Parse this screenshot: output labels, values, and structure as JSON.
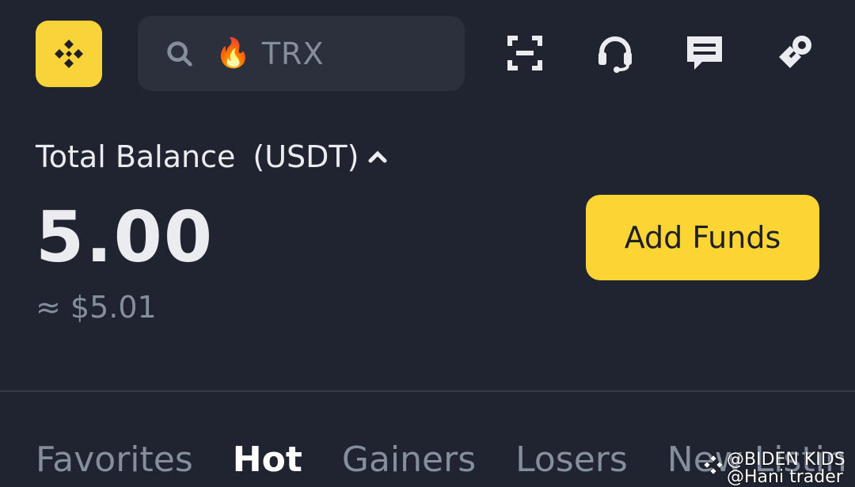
{
  "search": {
    "value": "TRX",
    "fire_icon": "🔥"
  },
  "icons": {
    "logo": "binance-logo-icon",
    "scan": "scan-icon",
    "support": "headset-icon",
    "messages": "chat-icon",
    "referral": "key-icon"
  },
  "balance": {
    "label": "Total Balance",
    "unit": "(USDT)",
    "value": "5.00",
    "approx": "≈ $5.01"
  },
  "actions": {
    "add_funds": "Add Funds"
  },
  "tabs": [
    {
      "label": "Favorites"
    },
    {
      "label": "Hot"
    },
    {
      "label": "Gainers"
    },
    {
      "label": "Losers"
    },
    {
      "label": "New Listin"
    }
  ],
  "watermark": {
    "line1": "@BIDEN KIDS",
    "line2": "@Hani trader"
  },
  "colors": {
    "background": "#1f2430",
    "accent": "#fcd535",
    "search_bg": "#2b303c",
    "muted_text": "#848e9c"
  }
}
